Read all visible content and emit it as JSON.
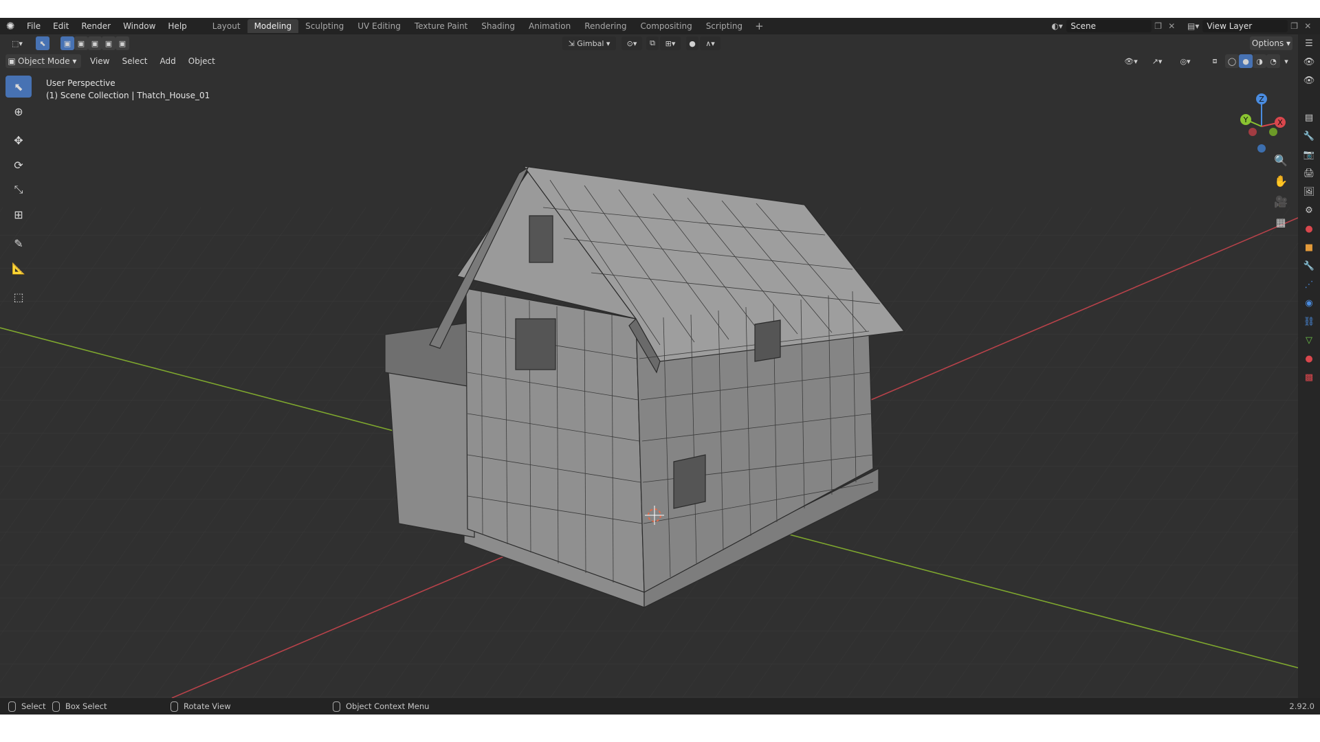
{
  "menu": [
    "File",
    "Edit",
    "Render",
    "Window",
    "Help"
  ],
  "workspaces": [
    "Layout",
    "Modeling",
    "Sculpting",
    "UV Editing",
    "Texture Paint",
    "Shading",
    "Animation",
    "Rendering",
    "Compositing",
    "Scripting"
  ],
  "active_workspace": "Modeling",
  "scene": {
    "label": "Scene"
  },
  "view_layer": {
    "label": "View Layer"
  },
  "header": {
    "transform_orientation": "Gimbal",
    "options_label": "Options"
  },
  "header2": {
    "mode": "Object Mode",
    "menus": [
      "View",
      "Select",
      "Add",
      "Object"
    ]
  },
  "viewport": {
    "perspective": "User Perspective",
    "collection_line": "(1) Scene Collection | Thatch_House_01"
  },
  "gizmo": {
    "x": "X",
    "y": "Y",
    "z": "Z"
  },
  "tools": [
    "select-box-tool",
    "cursor-tool",
    "move-tool",
    "rotate-tool",
    "scale-tool",
    "transform-tool",
    "annotate-tool",
    "measure-tool",
    "add-cube-tool"
  ],
  "status": {
    "select": "Select",
    "box_select": "Box Select",
    "rotate_view": "Rotate View",
    "context_menu": "Object Context Menu",
    "version": "2.92.0"
  },
  "colors": {
    "accent": "#4772b3",
    "axis_x": "#d9474d",
    "axis_y": "#8ac431",
    "axis_z": "#4a8ce0",
    "background": "#303030"
  }
}
